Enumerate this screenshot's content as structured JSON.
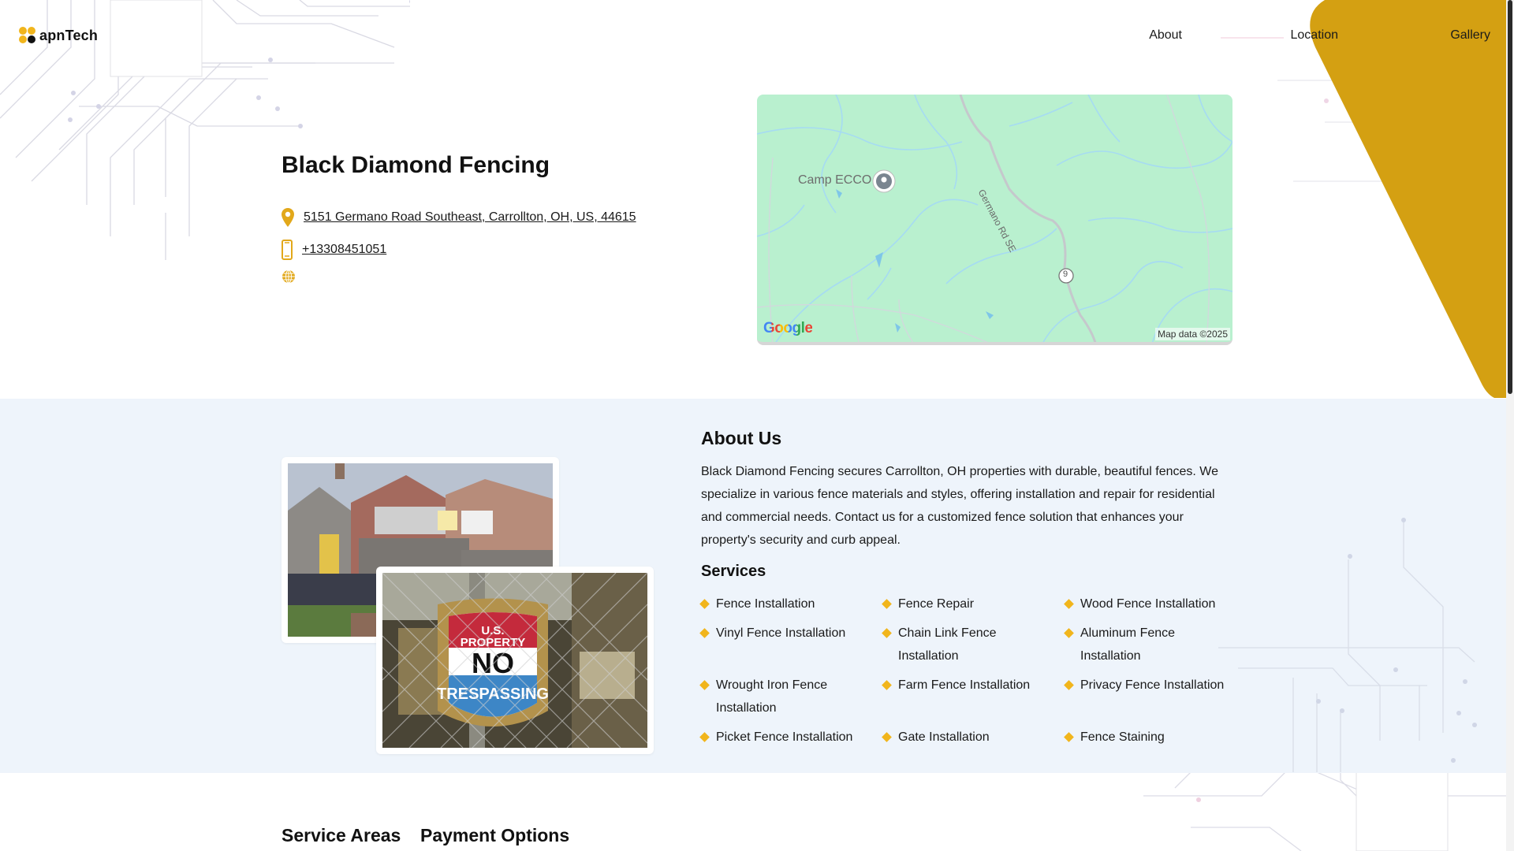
{
  "brand": {
    "logo_text": "apnTech",
    "accent": "#d4a012",
    "dot_colors": [
      "#f1b51c",
      "#f1b51c",
      "#111111",
      "#f1b51c"
    ]
  },
  "nav": {
    "about": "About",
    "location": "Location",
    "gallery": "Gallery"
  },
  "business": {
    "name": "Black Diamond Fencing",
    "address": "5151 Germano Road Southeast, Carrollton, OH, US, 44615",
    "phone": "+13308451051",
    "icons": [
      "location-pin-icon",
      "phone-icon",
      "globe-icon"
    ]
  },
  "map": {
    "place_label": "Camp ECCO",
    "road_label": "Germano Rd SE",
    "route_number": "9",
    "provider": "Google",
    "credit": "Map data ©2025"
  },
  "about": {
    "title": "About Us",
    "text": "Black Diamond Fencing secures Carrollton, OH properties with durable, beautiful fences. We specialize in various fence materials and styles, offering installation and repair for residential and commercial needs. Contact us for a customized fence solution that enhances your property's security and curb appeal.",
    "sign_lines": [
      "U.S.",
      "PROPERTY",
      "NO",
      "TRESPASSING"
    ]
  },
  "services": {
    "title": "Services",
    "items": [
      "Fence Installation",
      "Fence Repair",
      "Wood Fence Installation",
      "Vinyl Fence Installation",
      "Chain Link Fence Installation",
      "Aluminum Fence Installation",
      "Wrought Iron Fence Installation",
      "Farm Fence Installation",
      "Privacy Fence Installation",
      "Picket Fence Installation",
      "Gate Installation",
      "Fence Staining"
    ]
  },
  "bottom": {
    "service_areas": "Service Areas",
    "payment_options": "Payment Options"
  }
}
